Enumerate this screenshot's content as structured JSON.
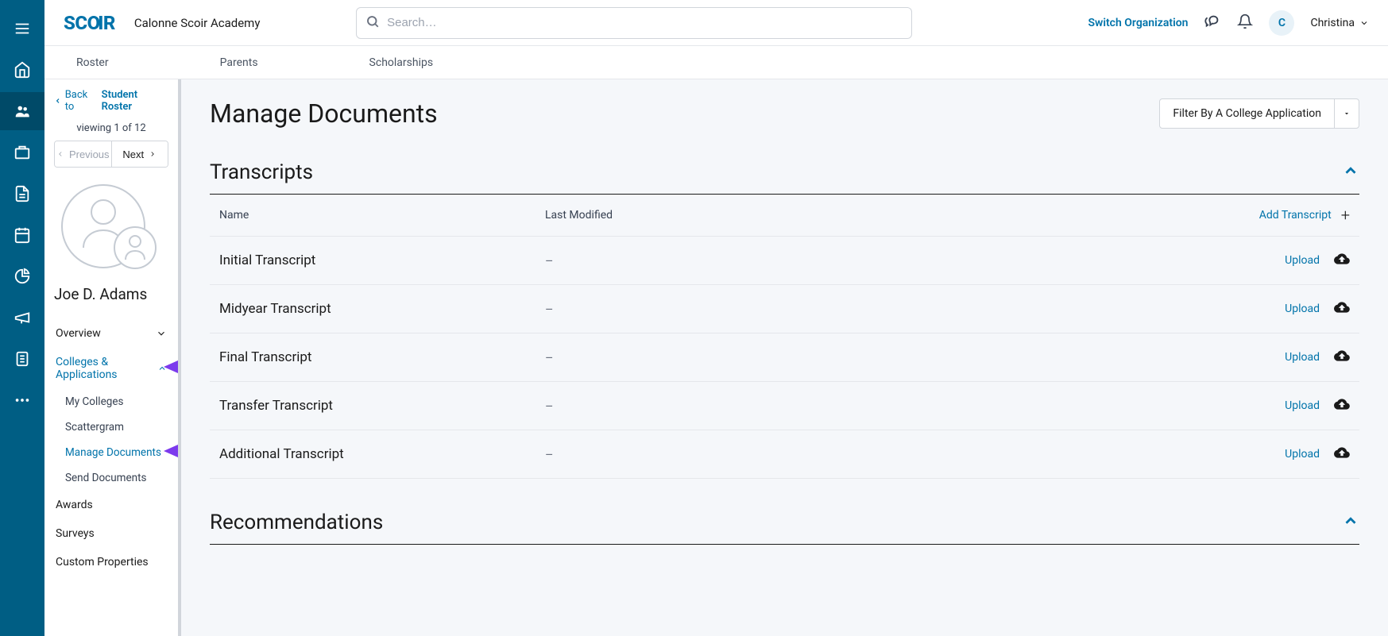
{
  "header": {
    "logo": "SCOIR",
    "org_name": "Calonne Scoir Academy",
    "search_placeholder": "Search…",
    "switch_org": "Switch Organization",
    "user_initial": "C",
    "user_name": "Christina"
  },
  "sec_nav": {
    "items": [
      "Roster",
      "Parents",
      "Scholarships"
    ]
  },
  "sidebar": {
    "back_prefix": "Back to",
    "back_target": "Student Roster",
    "viewing": "viewing 1 of 12",
    "prev": "Previous",
    "next": "Next",
    "student_name": "Joe D. Adams",
    "overview": "Overview",
    "colleges_apps": "Colleges & Applications",
    "subs": {
      "my_colleges": "My Colleges",
      "scattergram": "Scattergram",
      "manage_documents": "Manage Documents",
      "send_documents": "Send Documents"
    },
    "awards": "Awards",
    "surveys": "Surveys",
    "custom_properties": "Custom Properties"
  },
  "main": {
    "title": "Manage Documents",
    "filter_label": "Filter By A College Application",
    "sections": {
      "transcripts": {
        "title": "Transcripts",
        "col_name": "Name",
        "col_modified": "Last Modified",
        "add_label": "Add Transcript",
        "upload_label": "Upload",
        "rows": [
          {
            "name": "Initial Transcript",
            "modified": "–"
          },
          {
            "name": "Midyear Transcript",
            "modified": "–"
          },
          {
            "name": "Final Transcript",
            "modified": "–"
          },
          {
            "name": "Transfer Transcript",
            "modified": "–"
          },
          {
            "name": "Additional Transcript",
            "modified": "–"
          }
        ]
      },
      "recommendations": {
        "title": "Recommendations"
      }
    }
  }
}
